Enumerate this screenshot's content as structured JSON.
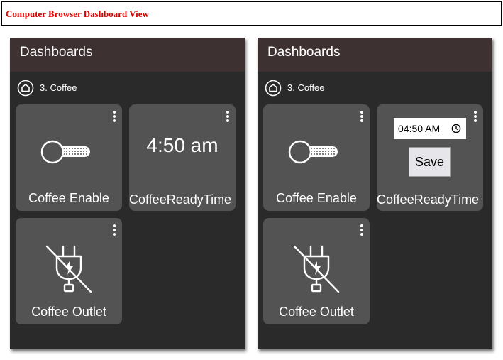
{
  "page_title": "Computer Browser Dashboard View",
  "colors": {
    "title_text": "#e00000",
    "panel_bg": "#2a2a2a",
    "header_bg": "#3d3231",
    "tile_bg": "#535353",
    "text": "#ffffff"
  },
  "panels": [
    {
      "header": "Dashboards",
      "breadcrumb": {
        "icon": "home-circle-icon",
        "label": "3. Coffee"
      },
      "tiles": [
        {
          "label": "Coffee Enable",
          "icon": "key-switch-icon"
        },
        {
          "label": "CoffeeReadyTime",
          "value": "4:50 am"
        },
        {
          "label": "Coffee Outlet",
          "icon": "outlet-off-icon"
        }
      ]
    },
    {
      "header": "Dashboards",
      "breadcrumb": {
        "icon": "home-circle-icon",
        "label": "3. Coffee"
      },
      "tiles": [
        {
          "label": "Coffee Enable",
          "icon": "key-switch-icon"
        },
        {
          "label": "CoffeeReadyTime",
          "time_input_value": "04:50 AM",
          "save_label": "Save"
        },
        {
          "label": "Coffee Outlet",
          "icon": "outlet-off-icon"
        }
      ]
    }
  ]
}
